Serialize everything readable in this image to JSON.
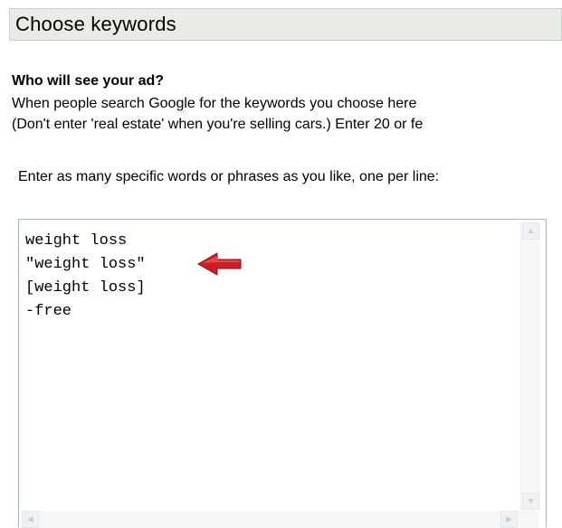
{
  "header": {
    "title": "Choose keywords"
  },
  "audience": {
    "heading": "Who will see your ad?",
    "description_lines": [
      "When people search Google for the keywords you choose here",
      "(Don't enter 'real estate' when you're selling cars.) Enter 20 or fe"
    ]
  },
  "keywords": {
    "instructions": "Enter as many specific words or phrases as you like, one per line:",
    "lines": [
      "weight loss",
      "\"weight loss\"",
      "[weight loss]",
      "-free"
    ]
  },
  "colors": {
    "header_bg": "#e8ebe6",
    "arrow": "#d4232b",
    "field_border": "#a7b2c5"
  },
  "icons": {
    "scroll_up": "scroll-up-arrow-icon",
    "scroll_down": "scroll-down-arrow-icon",
    "scroll_left": "scroll-left-arrow-icon",
    "scroll_right": "scroll-right-arrow-icon",
    "annotation": "red-arrow-icon"
  }
}
